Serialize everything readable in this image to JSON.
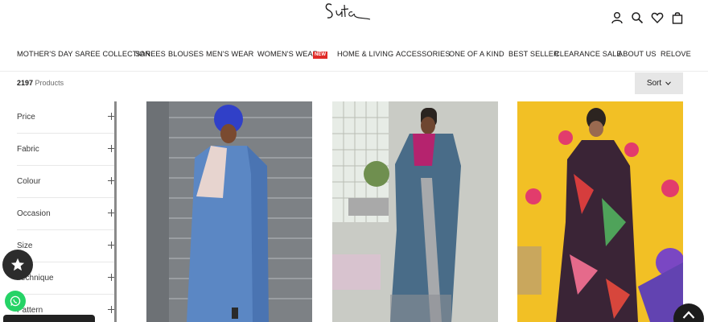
{
  "header": {
    "logo_icon": "suta-signature-logo",
    "icons": [
      "account-icon",
      "search-icon",
      "wishlist-heart-icon",
      "cart-bag-icon"
    ]
  },
  "nav": {
    "items": [
      "MOTHER'S DAY SAREE COLLECTION",
      "SAREES",
      "BLOUSES",
      "MEN'S WEAR",
      "WOMEN'S WEAR",
      "HOME & LIVING",
      "ACCESSORIES",
      "ONE OF A KIND",
      "BEST SELLER",
      "CLEARANCE SALE",
      "ABOUT US",
      "RELOVE"
    ],
    "new_badge": "NEW"
  },
  "toolbar": {
    "count_number": "2197",
    "count_suffix": "Products",
    "sort_label": "Sort"
  },
  "filters": [
    {
      "label": "Price"
    },
    {
      "label": "Fabric"
    },
    {
      "label": "Colour"
    },
    {
      "label": "Occasion"
    },
    {
      "label": "Size"
    },
    {
      "label": "Technique"
    },
    {
      "label": "Pattern"
    }
  ],
  "products": [
    {
      "name": "blue saree on stairs",
      "accent": "#5b87c4"
    },
    {
      "name": "grey-blue saree with silver border",
      "accent": "#496c88"
    },
    {
      "name": "multicolor floral saree on yellow backdrop",
      "accent": "#f2c025"
    }
  ],
  "colors": {
    "text": "#1c1b1b",
    "muted": "#6a6a6a",
    "sort_bg": "#e6e6e6",
    "badge_red": "#e02b27",
    "whatsapp_green": "#25d366"
  }
}
